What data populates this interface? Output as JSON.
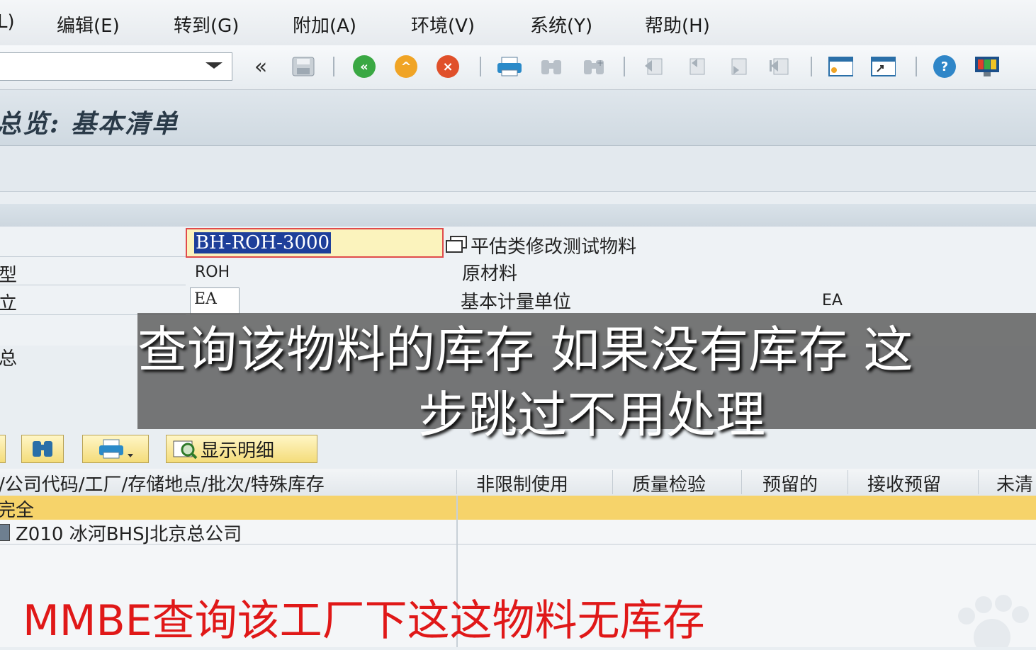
{
  "menu": [
    "L)",
    "编辑(E)",
    "转到(G)",
    "附加(A)",
    "环境(V)",
    "系统(Y)",
    "帮助(H)"
  ],
  "toolbar": {
    "back_label": "«"
  },
  "title": "总览: 基本清单",
  "form": {
    "material_value": "BH-ROH-3000",
    "material_desc": "平估类修改测试物料",
    "type_label": "型",
    "type_value": "ROH",
    "type_desc": "原材料",
    "uom_label": "立",
    "uom_value": "EA",
    "uom_desc": "基本计量单位",
    "uom_desc_value": "EA",
    "section_label": "总"
  },
  "subtitle": {
    "line1": "查询该物料的库存  如果没有库存  这",
    "line2": "步跳过不用处理"
  },
  "lower_toolbar": {
    "detail_label": "显示明细"
  },
  "table": {
    "columns": [
      "/公司代码/工厂/存储地点/批次/特殊库存",
      "非限制使用",
      "质量检验",
      "预留的",
      "接收预留",
      "未清"
    ],
    "total_row": "完全",
    "rows": [
      {
        "label": "Z010 冰河BHSJ北京总公司"
      }
    ]
  },
  "caption": "MMBE查询该工厂下这这物料无库存",
  "colors": {
    "highlight": "#f6d36a",
    "caption": "#e01818",
    "selection": "#1e3f9a"
  }
}
